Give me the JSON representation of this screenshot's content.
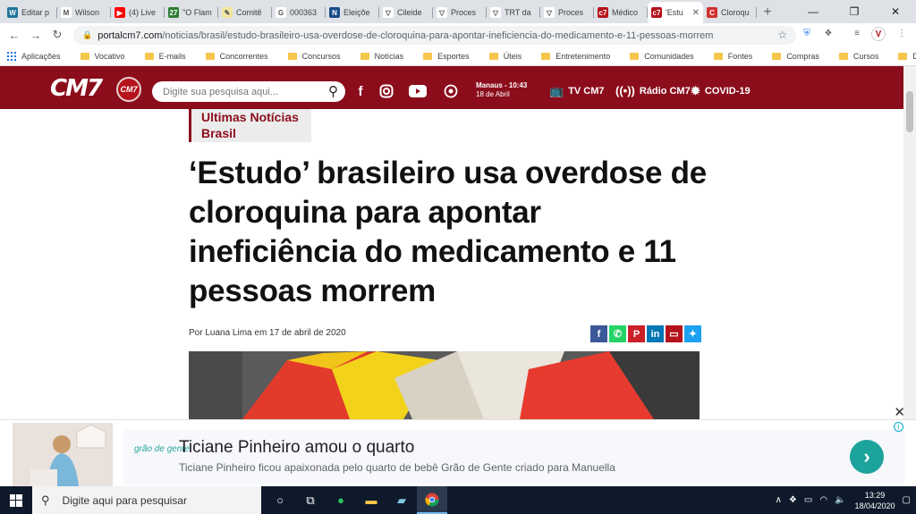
{
  "browser": {
    "tabs": [
      {
        "label": "Editar p",
        "fav_color": "#21759b",
        "fav_char": "W"
      },
      {
        "label": "Wilson",
        "fav_color": "#ffffff",
        "fav_char": "M"
      },
      {
        "label": "(4) Live",
        "fav_color": "#ff0000",
        "fav_char": "▶"
      },
      {
        "label": "\"O Flam",
        "fav_color": "#2e7d32",
        "fav_char": "27"
      },
      {
        "label": "Comitê",
        "fav_color": "#f0e6a0",
        "fav_char": "✎"
      },
      {
        "label": "000363",
        "fav_color": "#ffffff",
        "fav_char": "G"
      },
      {
        "label": "Eleiçõe",
        "fav_color": "#1a4c8b",
        "fav_char": "N"
      },
      {
        "label": "Cileide",
        "fav_color": "#ffffff",
        "fav_char": "▽"
      },
      {
        "label": "Proces",
        "fav_color": "#ffffff",
        "fav_char": "▽"
      },
      {
        "label": "TRT da",
        "fav_color": "#ffffff",
        "fav_char": "▽"
      },
      {
        "label": "Proces",
        "fav_color": "#ffffff",
        "fav_char": "▽"
      },
      {
        "label": "Médico",
        "fav_color": "#b5121b",
        "fav_char": "c7"
      },
      {
        "label": "'Estu",
        "fav_color": "#b5121b",
        "fav_char": "c7",
        "active": true
      },
      {
        "label": "Cloroqu",
        "fav_color": "#d32f2f",
        "fav_char": "C"
      }
    ],
    "new_tab": "+",
    "window_controls": {
      "minimize": "—",
      "restore": "❐",
      "close": "✕"
    },
    "nav": {
      "back": "←",
      "forward": "→",
      "reload": "↻"
    },
    "url_domain": "portalcm7.com",
    "url_path": "/noticias/brasil/estudo-brasileiro-usa-overdose-de-cloroquina-para-apontar-ineficiencia-do-medicamento-e-11-pessoas-morrem",
    "bookmarks": [
      "Aplicações",
      "Vocativo",
      "E-mails",
      "Concorrentes",
      "Concursos",
      "Notícias",
      "Esportes",
      "Úteis",
      "Entretenimento",
      "Comunidades",
      "Fontes",
      "Compras",
      "Cursos",
      "Doutorado"
    ]
  },
  "site": {
    "logo": "CM7",
    "logo_badge": "CM7",
    "search_placeholder": "Digite sua pesquisa aqui...",
    "weather_city": "Manaus - 10:43",
    "weather_date": "18 de Abril",
    "links": {
      "tv": "TV CM7",
      "radio": "Rádio CM7",
      "covid": "COVID-19"
    }
  },
  "article": {
    "category_line1": "Ultimas Notícias",
    "category_line2": "Brasil",
    "headline": "‘Estudo’ brasileiro usa overdose de cloroquina para apontar ineficiência do medicamento e 11 pessoas morrem",
    "byline": "Por Luana Lima em 17 de abril de 2020",
    "share_colors": [
      "#3b5998",
      "#25d366",
      "#cb2027",
      "#0077b5",
      "#b5121b",
      "#1da1f2"
    ]
  },
  "ad": {
    "brand": "grão de gente",
    "title": "Ticiane Pinheiro amou o quarto",
    "subtitle": "Ticiane Pinheiro ficou apaixonada pelo quarto de bebê Grão de Gente criado para Manuella",
    "cta": "›",
    "close": "✕",
    "info": "i"
  },
  "taskbar": {
    "search_placeholder": "Digite aqui para pesquisar",
    "time": "13:29",
    "date": "18/04/2020"
  }
}
